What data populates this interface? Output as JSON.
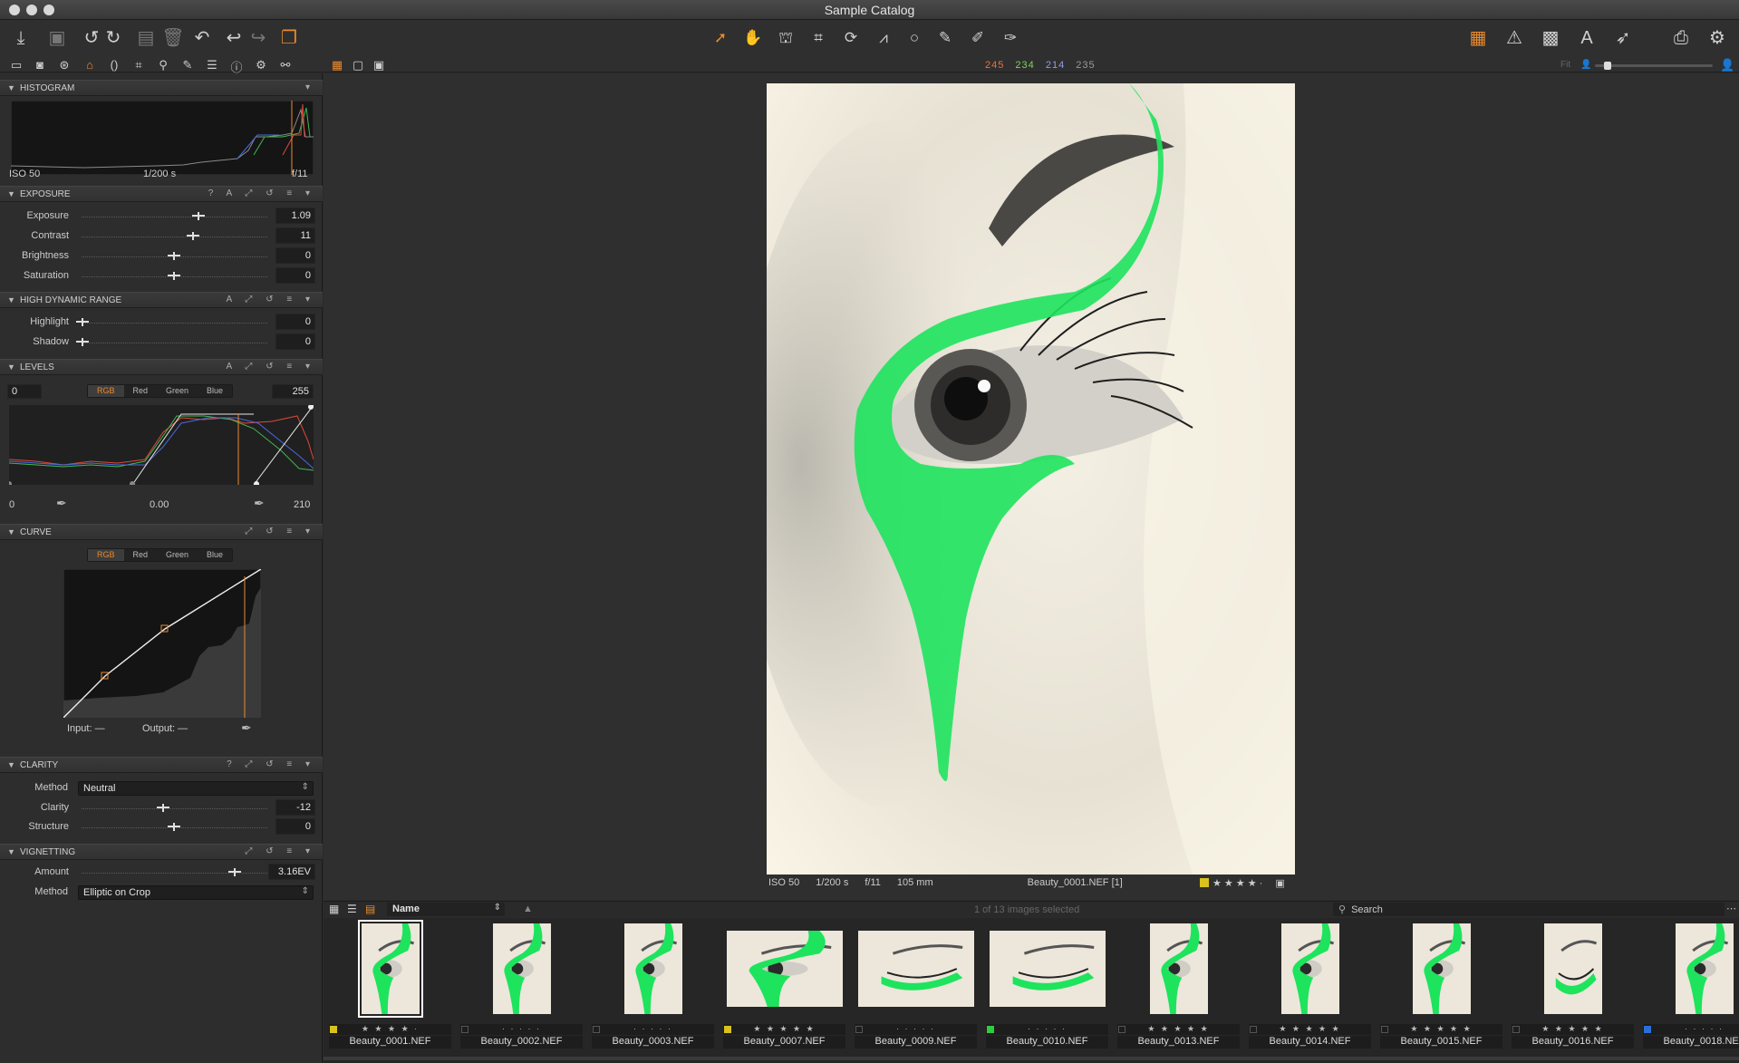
{
  "window": {
    "title": "Sample Catalog"
  },
  "toolbar": {
    "left_icons": [
      "import-icon",
      "camera-icon",
      "rotate-left-icon",
      "rotate-right-icon",
      "move-icon",
      "trash-icon",
      "undo-icon",
      "undo-arrow-icon",
      "redo-arrow-icon",
      "variants-icon"
    ],
    "cursor_tools": [
      "select-arrow-icon",
      "pan-hand-icon",
      "stamp-icon",
      "crop-icon",
      "rotate-icon",
      "keystone-icon",
      "circle-icon",
      "brush-icon",
      "eraser-icon",
      "picker-icon"
    ],
    "right_icons": [
      "grid-layout-icon",
      "warning-icon",
      "grid-icon",
      "text-icon",
      "pen-icon",
      "print-icon",
      "gear-icon"
    ]
  },
  "tool_tabs": [
    "library-icon",
    "camera-tab-icon",
    "color-tab-icon",
    "exposure-tab-icon",
    "lens-tab-icon",
    "crop-tab-icon",
    "focus-tab-icon",
    "brush-tab-icon",
    "metadata-tab-icon",
    "info-tab-icon",
    "settings-tab-icon",
    "batch-tab-icon"
  ],
  "rgb_readout": {
    "r": "245",
    "g": "234",
    "b": "214",
    "l": "235"
  },
  "zoom": {
    "label": "Fit"
  },
  "histogram": {
    "title": "HISTOGRAM",
    "iso": "ISO 50",
    "shutter": "1/200 s",
    "aperture": "f/11"
  },
  "exposure": {
    "title": "EXPOSURE",
    "rows": [
      {
        "label": "Exposure",
        "value": "1.09"
      },
      {
        "label": "Contrast",
        "value": "11"
      },
      {
        "label": "Brightness",
        "value": "0"
      },
      {
        "label": "Saturation",
        "value": "0"
      }
    ]
  },
  "hdr": {
    "title": "HIGH DYNAMIC RANGE",
    "rows": [
      {
        "label": "Highlight",
        "value": "0"
      },
      {
        "label": "Shadow",
        "value": "0"
      }
    ]
  },
  "levels": {
    "title": "LEVELS",
    "channels": [
      "RGB",
      "Red",
      "Green",
      "Blue"
    ],
    "input_low": "0",
    "input_high": "255",
    "output_low": "0",
    "midtone": "0.00",
    "output_high": "210"
  },
  "curve": {
    "title": "CURVE",
    "channels": [
      "RGB",
      "Red",
      "Green",
      "Blue"
    ],
    "input_label": "Input:",
    "input_value": "—",
    "output_label": "Output:",
    "output_value": "—"
  },
  "clarity": {
    "title": "CLARITY",
    "method_label": "Method",
    "method_value": "Neutral",
    "rows": [
      {
        "label": "Clarity",
        "value": "-12"
      },
      {
        "label": "Structure",
        "value": "0"
      }
    ]
  },
  "vignetting": {
    "title": "VIGNETTING",
    "amount_label": "Amount",
    "amount_value": "3.16EV",
    "method_label": "Method",
    "method_value": "Elliptic on Crop"
  },
  "viewer": {
    "iso": "ISO 50",
    "shutter": "1/200 s",
    "aperture": "f/11",
    "focal": "105 mm",
    "filename": "Beauty_0001.NEF [1]",
    "stars": "★ ★ ★ ★ ·",
    "color_tag": "#d9c21f"
  },
  "browser": {
    "sort_label": "Name",
    "selection": "1 of 13 images selected",
    "search_placeholder": "Search"
  },
  "thumbnails": [
    {
      "name": "Beauty_0001.NEF",
      "stars": "★ ★ ★ ★ ·",
      "tag": "#d9c21f",
      "orient": "portrait",
      "selected": true,
      "eye": "open"
    },
    {
      "name": "Beauty_0002.NEF",
      "stars": "· · · · ·",
      "tag": "",
      "orient": "portrait",
      "selected": false,
      "eye": "side"
    },
    {
      "name": "Beauty_0003.NEF",
      "stars": "· · · · ·",
      "tag": "",
      "orient": "portrait",
      "selected": false,
      "eye": "open"
    },
    {
      "name": "Beauty_0007.NEF",
      "stars": "★ ★ ★ ★ ★",
      "tag": "#d9c21f",
      "orient": "landscape",
      "selected": false,
      "eye": "open"
    },
    {
      "name": "Beauty_0009.NEF",
      "stars": "· · · · ·",
      "tag": "",
      "orient": "landscape",
      "selected": false,
      "eye": "closed"
    },
    {
      "name": "Beauty_0010.NEF",
      "stars": "· · · · ·",
      "tag": "#2ecc40",
      "orient": "landscape",
      "selected": false,
      "eye": "closed"
    },
    {
      "name": "Beauty_0013.NEF",
      "stars": "★ ★ ★ ★ ★",
      "tag": "",
      "orient": "portrait",
      "selected": false,
      "eye": "open"
    },
    {
      "name": "Beauty_0014.NEF",
      "stars": "★ ★ ★ ★ ★",
      "tag": "",
      "orient": "portrait",
      "selected": false,
      "eye": "open"
    },
    {
      "name": "Beauty_0015.NEF",
      "stars": "★ ★ ★ ★ ★",
      "tag": "",
      "orient": "portrait",
      "selected": false,
      "eye": "open"
    },
    {
      "name": "Beauty_0016.NEF",
      "stars": "★ ★ ★ ★ ★",
      "tag": "",
      "orient": "portrait",
      "selected": false,
      "eye": "closed"
    },
    {
      "name": "Beauty_0018.NEF",
      "stars": "· · · · ·",
      "tag": "#2a6fd6",
      "orient": "portrait",
      "selected": false,
      "eye": "open"
    }
  ]
}
